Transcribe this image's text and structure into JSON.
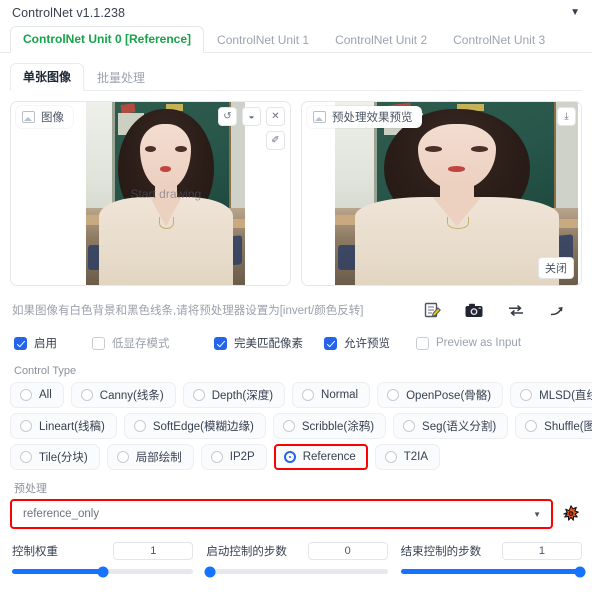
{
  "accordion": {
    "title": "ControlNet v1.1.238",
    "caret": "▼"
  },
  "tabs": [
    {
      "label": "ControlNet Unit 0 [Reference]",
      "active": true
    },
    {
      "label": "ControlNet Unit 1",
      "active": false
    },
    {
      "label": "ControlNet Unit 2",
      "active": false
    },
    {
      "label": "ControlNet Unit 3",
      "active": false
    }
  ],
  "subtabs": [
    {
      "label": "单张图像",
      "active": true
    },
    {
      "label": "批量处理",
      "active": false
    }
  ],
  "image_panel": {
    "badge": "图像",
    "watermark": "Start drawing",
    "tools": [
      {
        "name": "undo-icon",
        "glyph": "↺"
      },
      {
        "name": "eraser-icon",
        "glyph": "◒"
      },
      {
        "name": "close-icon",
        "glyph": "✕"
      },
      {
        "name": "brush-icon",
        "glyph": "✐"
      }
    ]
  },
  "preview_panel": {
    "badge": "预处理效果预览",
    "download_icon": "⤓",
    "close_label": "关闭"
  },
  "hint": {
    "text": "如果图像有白色背景和黑色线条,请将预处理器设置为[invert/颜色反转]",
    "icons": [
      {
        "name": "edit-note-icon"
      },
      {
        "name": "camera-icon"
      },
      {
        "name": "swap-arrows-icon"
      },
      {
        "name": "arrow-turn-icon"
      }
    ]
  },
  "checkboxes": [
    {
      "label": "启用",
      "checked": true,
      "muted": false
    },
    {
      "label": "低显存模式",
      "checked": false,
      "muted": true
    },
    {
      "label": "完美匹配像素",
      "checked": true,
      "muted": false
    },
    {
      "label": "允许预览",
      "checked": true,
      "muted": false
    },
    {
      "label": "Preview as Input",
      "checked": false,
      "muted": true
    }
  ],
  "control_type": {
    "label": "Control Type",
    "rows": [
      [
        {
          "label": "All",
          "selected": false,
          "highlight": false
        },
        {
          "label": "Canny(线条)",
          "selected": false,
          "highlight": false
        },
        {
          "label": "Depth(深度)",
          "selected": false,
          "highlight": false
        },
        {
          "label": "Normal",
          "selected": false,
          "highlight": false
        },
        {
          "label": "OpenPose(骨骼)",
          "selected": false,
          "highlight": false
        },
        {
          "label": "MLSD(直线)",
          "selected": false,
          "highlight": false
        }
      ],
      [
        {
          "label": "Lineart(线稿)",
          "selected": false,
          "highlight": false
        },
        {
          "label": "SoftEdge(模糊边缘)",
          "selected": false,
          "highlight": false
        },
        {
          "label": "Scribble(涂鸦)",
          "selected": false,
          "highlight": false
        },
        {
          "label": "Seg(语义分割)",
          "selected": false,
          "highlight": false
        },
        {
          "label": "Shuffle(图像打乱)",
          "selected": false,
          "highlight": false
        }
      ],
      [
        {
          "label": "Tile(分块)",
          "selected": false,
          "highlight": false
        },
        {
          "label": "局部绘制",
          "selected": false,
          "highlight": false
        },
        {
          "label": "IP2P",
          "selected": false,
          "highlight": false
        },
        {
          "label": "Reference",
          "selected": true,
          "highlight": true
        },
        {
          "label": "T2IA",
          "selected": false,
          "highlight": false
        }
      ]
    ]
  },
  "preprocessor": {
    "label": "预处理",
    "value": "reference_only",
    "caret": "▼",
    "explode_icon": "explode-icon"
  },
  "sliders": [
    {
      "name": "控制权重",
      "value": "1",
      "percent": 50
    },
    {
      "name": "启动控制的步数",
      "value": "0",
      "percent": 2
    },
    {
      "name": "结束控制的步数",
      "value": "1",
      "percent": 100
    }
  ]
}
